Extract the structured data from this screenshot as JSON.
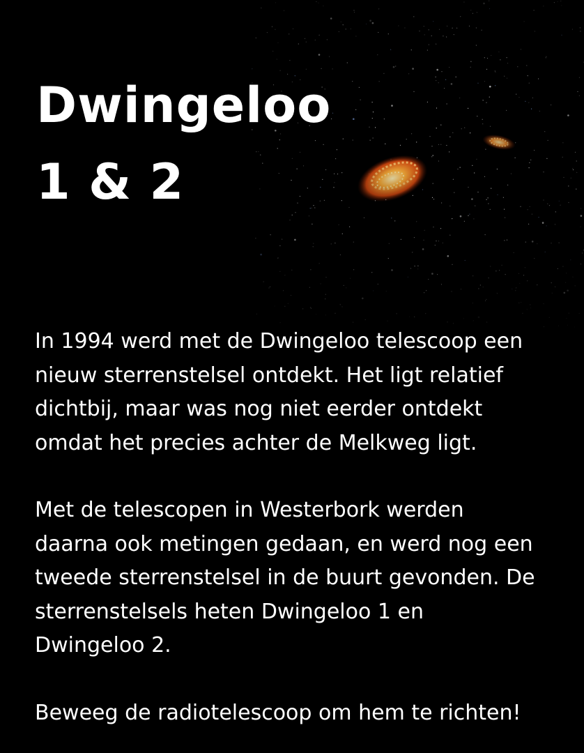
{
  "title": {
    "line1": "Dwingeloo",
    "line2": "1 & 2"
  },
  "paragraphs": [
    "In 1994 werd met de Dwingeloo telescoop een\nnieuw sterrenstelsel ontdekt. Het ligt relatief\ndichtbij, maar was nog niet eerder ontdekt\nomdat het precies achter de Melkweg ligt.",
    "Met de telescopen in Westerbork werden\ndaarna ook metingen gedaan, en werd nog een\ntweede sterrenstelsel in de buurt gevonden. De\nsterrenstelsels heten Dwingeloo 1 en\nDwingeloo 2.",
    "Beweeg de radiotelescoop om hem te richten!"
  ],
  "colors": {
    "background": "#000000",
    "text": "#ffffff",
    "galaxy_core": "#ffd27a",
    "galaxy_edge": "#c2360c"
  }
}
